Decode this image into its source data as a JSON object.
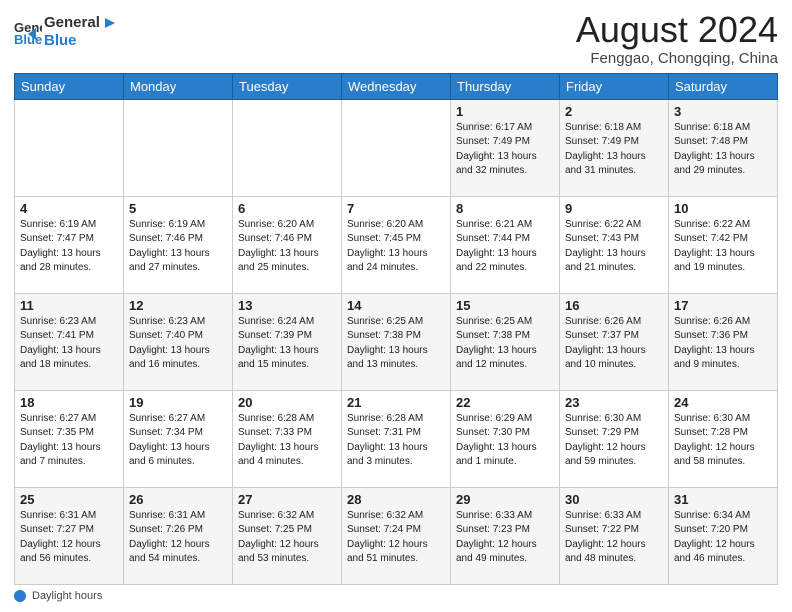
{
  "header": {
    "logo_line1": "General",
    "logo_line2": "Blue",
    "month_year": "August 2024",
    "location": "Fenggao, Chongqing, China"
  },
  "days_of_week": [
    "Sunday",
    "Monday",
    "Tuesday",
    "Wednesday",
    "Thursday",
    "Friday",
    "Saturday"
  ],
  "footer": {
    "label": "Daylight hours"
  },
  "weeks": [
    [
      {
        "day": "",
        "info": ""
      },
      {
        "day": "",
        "info": ""
      },
      {
        "day": "",
        "info": ""
      },
      {
        "day": "",
        "info": ""
      },
      {
        "day": "1",
        "info": "Sunrise: 6:17 AM\nSunset: 7:49 PM\nDaylight: 13 hours\nand 32 minutes."
      },
      {
        "day": "2",
        "info": "Sunrise: 6:18 AM\nSunset: 7:49 PM\nDaylight: 13 hours\nand 31 minutes."
      },
      {
        "day": "3",
        "info": "Sunrise: 6:18 AM\nSunset: 7:48 PM\nDaylight: 13 hours\nand 29 minutes."
      }
    ],
    [
      {
        "day": "4",
        "info": "Sunrise: 6:19 AM\nSunset: 7:47 PM\nDaylight: 13 hours\nand 28 minutes."
      },
      {
        "day": "5",
        "info": "Sunrise: 6:19 AM\nSunset: 7:46 PM\nDaylight: 13 hours\nand 27 minutes."
      },
      {
        "day": "6",
        "info": "Sunrise: 6:20 AM\nSunset: 7:46 PM\nDaylight: 13 hours\nand 25 minutes."
      },
      {
        "day": "7",
        "info": "Sunrise: 6:20 AM\nSunset: 7:45 PM\nDaylight: 13 hours\nand 24 minutes."
      },
      {
        "day": "8",
        "info": "Sunrise: 6:21 AM\nSunset: 7:44 PM\nDaylight: 13 hours\nand 22 minutes."
      },
      {
        "day": "9",
        "info": "Sunrise: 6:22 AM\nSunset: 7:43 PM\nDaylight: 13 hours\nand 21 minutes."
      },
      {
        "day": "10",
        "info": "Sunrise: 6:22 AM\nSunset: 7:42 PM\nDaylight: 13 hours\nand 19 minutes."
      }
    ],
    [
      {
        "day": "11",
        "info": "Sunrise: 6:23 AM\nSunset: 7:41 PM\nDaylight: 13 hours\nand 18 minutes."
      },
      {
        "day": "12",
        "info": "Sunrise: 6:23 AM\nSunset: 7:40 PM\nDaylight: 13 hours\nand 16 minutes."
      },
      {
        "day": "13",
        "info": "Sunrise: 6:24 AM\nSunset: 7:39 PM\nDaylight: 13 hours\nand 15 minutes."
      },
      {
        "day": "14",
        "info": "Sunrise: 6:25 AM\nSunset: 7:38 PM\nDaylight: 13 hours\nand 13 minutes."
      },
      {
        "day": "15",
        "info": "Sunrise: 6:25 AM\nSunset: 7:38 PM\nDaylight: 13 hours\nand 12 minutes."
      },
      {
        "day": "16",
        "info": "Sunrise: 6:26 AM\nSunset: 7:37 PM\nDaylight: 13 hours\nand 10 minutes."
      },
      {
        "day": "17",
        "info": "Sunrise: 6:26 AM\nSunset: 7:36 PM\nDaylight: 13 hours\nand 9 minutes."
      }
    ],
    [
      {
        "day": "18",
        "info": "Sunrise: 6:27 AM\nSunset: 7:35 PM\nDaylight: 13 hours\nand 7 minutes."
      },
      {
        "day": "19",
        "info": "Sunrise: 6:27 AM\nSunset: 7:34 PM\nDaylight: 13 hours\nand 6 minutes."
      },
      {
        "day": "20",
        "info": "Sunrise: 6:28 AM\nSunset: 7:33 PM\nDaylight: 13 hours\nand 4 minutes."
      },
      {
        "day": "21",
        "info": "Sunrise: 6:28 AM\nSunset: 7:31 PM\nDaylight: 13 hours\nand 3 minutes."
      },
      {
        "day": "22",
        "info": "Sunrise: 6:29 AM\nSunset: 7:30 PM\nDaylight: 13 hours\nand 1 minute."
      },
      {
        "day": "23",
        "info": "Sunrise: 6:30 AM\nSunset: 7:29 PM\nDaylight: 12 hours\nand 59 minutes."
      },
      {
        "day": "24",
        "info": "Sunrise: 6:30 AM\nSunset: 7:28 PM\nDaylight: 12 hours\nand 58 minutes."
      }
    ],
    [
      {
        "day": "25",
        "info": "Sunrise: 6:31 AM\nSunset: 7:27 PM\nDaylight: 12 hours\nand 56 minutes."
      },
      {
        "day": "26",
        "info": "Sunrise: 6:31 AM\nSunset: 7:26 PM\nDaylight: 12 hours\nand 54 minutes."
      },
      {
        "day": "27",
        "info": "Sunrise: 6:32 AM\nSunset: 7:25 PM\nDaylight: 12 hours\nand 53 minutes."
      },
      {
        "day": "28",
        "info": "Sunrise: 6:32 AM\nSunset: 7:24 PM\nDaylight: 12 hours\nand 51 minutes."
      },
      {
        "day": "29",
        "info": "Sunrise: 6:33 AM\nSunset: 7:23 PM\nDaylight: 12 hours\nand 49 minutes."
      },
      {
        "day": "30",
        "info": "Sunrise: 6:33 AM\nSunset: 7:22 PM\nDaylight: 12 hours\nand 48 minutes."
      },
      {
        "day": "31",
        "info": "Sunrise: 6:34 AM\nSunset: 7:20 PM\nDaylight: 12 hours\nand 46 minutes."
      }
    ]
  ]
}
